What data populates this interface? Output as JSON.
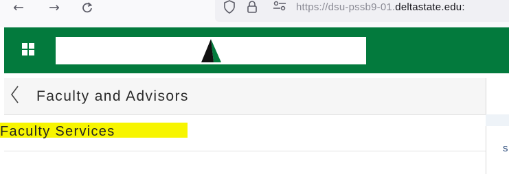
{
  "browser": {
    "url_prefix": "https://dsu-pssb9-01.",
    "url_domain": "deltastate.edu:",
    "icons": [
      "back-arrow-icon",
      "forward-arrow-icon",
      "reload-icon",
      "shield-icon",
      "lock-icon",
      "permissions-icon"
    ]
  },
  "header": {
    "background_color": "#037a3d",
    "icons": [
      "app-grid-icon",
      "delta-state-logo"
    ]
  },
  "page": {
    "title": "Faculty and Advisors",
    "back_icon": "chevron-left-icon"
  },
  "menu": {
    "items": [
      {
        "label": "Faculty Services",
        "highlight_color": "#f7f500"
      }
    ]
  },
  "background": {
    "fragment_text": "s"
  }
}
